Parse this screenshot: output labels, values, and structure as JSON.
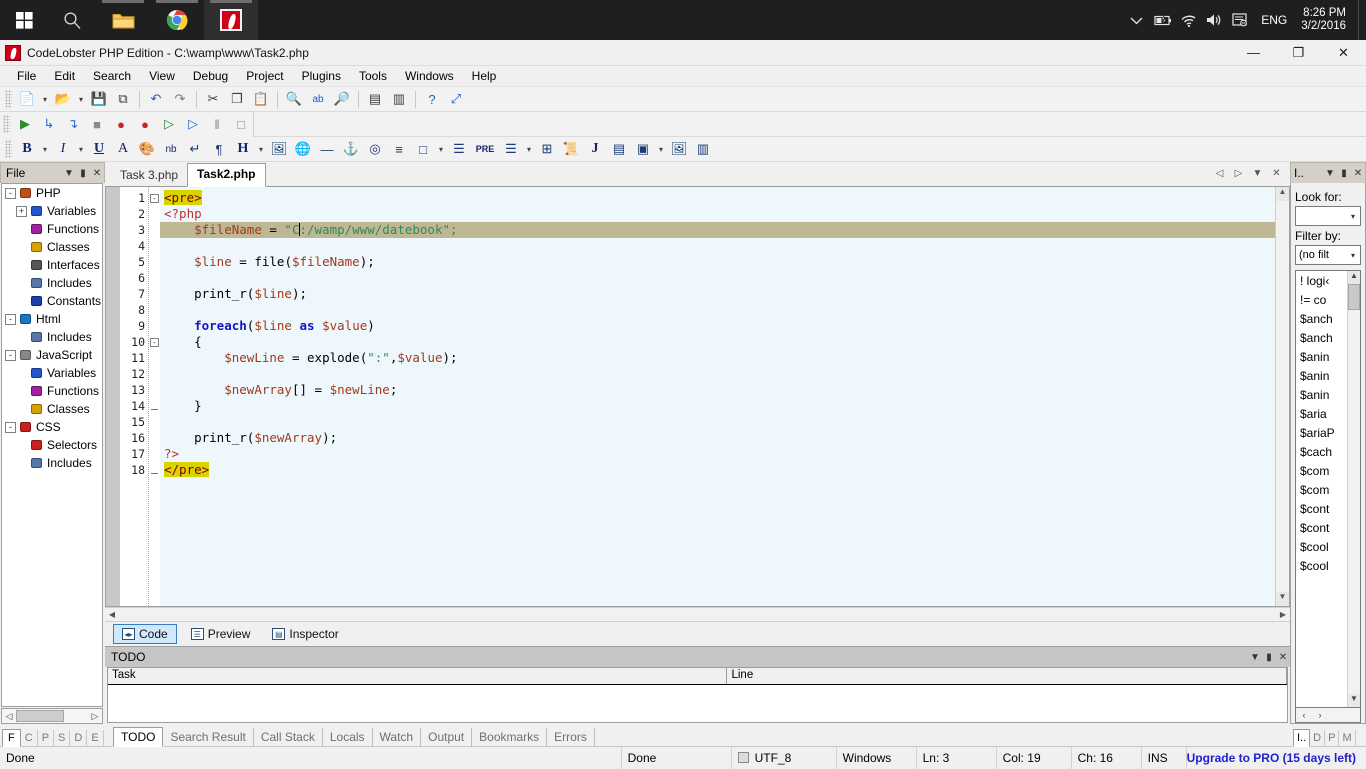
{
  "taskbar": {
    "start_icon": "windows-logo-icon",
    "items": [
      {
        "name": "search-icon",
        "glyph": "search"
      },
      {
        "name": "file-explorer-icon",
        "glyph": "folder"
      },
      {
        "name": "chrome-icon",
        "glyph": "chrome"
      },
      {
        "name": "codelobster-icon",
        "glyph": "codelobster",
        "active": true
      }
    ],
    "tray": {
      "chevron": "show-hidden-icons",
      "battery": "battery-charging-icon",
      "network": "wifi-icon",
      "volume": "speaker-icon",
      "action_center": "action-center-icon",
      "language": "ENG",
      "time": "8:26 PM",
      "date": "3/2/2016"
    }
  },
  "window": {
    "title": "CodeLobster PHP Edition - C:\\wamp\\www\\Task2.php",
    "minimize": "—",
    "maximize": "❐",
    "close": "✕"
  },
  "menu": [
    "File",
    "Edit",
    "Search",
    "View",
    "Debug",
    "Project",
    "Plugins",
    "Tools",
    "Windows",
    "Help"
  ],
  "toolbars": {
    "main": [
      {
        "name": "new-file-icon",
        "glyph": "📄"
      },
      {
        "name": "new-file-dropdown-icon",
        "glyph": "▾",
        "dd": true
      },
      {
        "name": "open-file-icon",
        "glyph": "📂"
      },
      {
        "name": "open-file-dropdown-icon",
        "glyph": "▾",
        "dd": true
      },
      {
        "name": "save-icon",
        "glyph": "💾"
      },
      {
        "name": "save-all-icon",
        "glyph": "⧉"
      },
      {
        "name": "separator",
        "glyph": "",
        "sep": true
      },
      {
        "name": "undo-icon",
        "glyph": "↶"
      },
      {
        "name": "redo-icon",
        "glyph": "↷"
      },
      {
        "name": "separator",
        "glyph": "",
        "sep": true
      },
      {
        "name": "cut-icon",
        "glyph": "✂"
      },
      {
        "name": "copy-icon",
        "glyph": "❐"
      },
      {
        "name": "paste-icon",
        "glyph": "📋"
      },
      {
        "name": "separator",
        "glyph": "",
        "sep": true
      },
      {
        "name": "find-icon",
        "glyph": "🔍"
      },
      {
        "name": "replace-icon",
        "glyph": "ab"
      },
      {
        "name": "find-in-files-icon",
        "glyph": "🔎"
      },
      {
        "name": "separator",
        "glyph": "",
        "sep": true
      },
      {
        "name": "split-view-icon",
        "glyph": "▤"
      },
      {
        "name": "project-properties-icon",
        "glyph": "▥"
      },
      {
        "name": "separator",
        "glyph": "",
        "sep": true
      },
      {
        "name": "help-icon",
        "glyph": "?"
      },
      {
        "name": "fullscreen-icon",
        "glyph": "⤢"
      }
    ],
    "debug": [
      {
        "name": "run-icon",
        "glyph": "▶"
      },
      {
        "name": "step-into-icon",
        "glyph": "↳"
      },
      {
        "name": "step-over-icon",
        "glyph": "↴"
      },
      {
        "name": "stop-icon",
        "glyph": "■"
      },
      {
        "name": "breakpoint-icon",
        "glyph": "●"
      },
      {
        "name": "remove-breakpoints-icon",
        "glyph": "●"
      },
      {
        "name": "run-to-cursor-icon",
        "glyph": "▷"
      },
      {
        "name": "continue-icon",
        "glyph": "▷"
      },
      {
        "name": "pause-icon",
        "glyph": "‖"
      },
      {
        "name": "terminate-icon",
        "glyph": "□"
      }
    ],
    "format": [
      {
        "name": "bold-icon",
        "glyph": "B"
      },
      {
        "name": "bold-dropdown-icon",
        "glyph": "▾",
        "dd": true
      },
      {
        "name": "italic-icon",
        "glyph": "I"
      },
      {
        "name": "italic-dropdown-icon",
        "glyph": "▾",
        "dd": true
      },
      {
        "name": "underline-icon",
        "glyph": "U"
      },
      {
        "name": "font-color-icon",
        "glyph": "A"
      },
      {
        "name": "palette-icon",
        "glyph": "🎨"
      },
      {
        "name": "nbsp-icon",
        "glyph": "nb"
      },
      {
        "name": "line-break-icon",
        "glyph": "↵"
      },
      {
        "name": "paragraph-icon",
        "glyph": "¶"
      },
      {
        "name": "heading-icon",
        "glyph": "H"
      },
      {
        "name": "heading-dropdown-icon",
        "glyph": "▾",
        "dd": true
      },
      {
        "name": "insert-image-icon",
        "glyph": "🖼"
      },
      {
        "name": "insert-link-icon",
        "glyph": "🌐"
      },
      {
        "name": "horizontal-rule-icon",
        "glyph": "—"
      },
      {
        "name": "anchor-icon",
        "glyph": "⚓"
      },
      {
        "name": "target-icon",
        "glyph": "◎"
      },
      {
        "name": "align-icon",
        "glyph": "≡"
      },
      {
        "name": "div-icon",
        "glyph": "□"
      },
      {
        "name": "div-dropdown-icon",
        "glyph": "▾",
        "dd": true
      },
      {
        "name": "align-justify-icon",
        "glyph": "☰"
      },
      {
        "name": "pre-icon",
        "glyph": "PRE"
      },
      {
        "name": "list-icon",
        "glyph": "☰"
      },
      {
        "name": "list-dropdown-icon",
        "glyph": "▾",
        "dd": true
      },
      {
        "name": "table-icon",
        "glyph": "⊞"
      },
      {
        "name": "script-icon",
        "glyph": "📜"
      },
      {
        "name": "javascript-icon",
        "glyph": "J"
      },
      {
        "name": "form-icon",
        "glyph": "▤"
      },
      {
        "name": "form-element-icon",
        "glyph": "▣"
      },
      {
        "name": "form-element-dropdown-icon",
        "glyph": "▾",
        "dd": true
      },
      {
        "name": "insert-media-icon",
        "glyph": "🖼"
      },
      {
        "name": "frames-icon",
        "glyph": "▥"
      }
    ]
  },
  "left_dock": {
    "title": "File",
    "controls": {
      "menu": "▼",
      "pin": "▮",
      "close": "✕"
    },
    "tree": [
      {
        "label": "PHP",
        "level": 0,
        "toggle": "-",
        "icon": "php-icon",
        "color": "#c05018"
      },
      {
        "label": "Variables",
        "level": 1,
        "toggle": "+",
        "icon": "variable-icon",
        "color": "#2255cc"
      },
      {
        "label": "Functions",
        "level": 1,
        "toggle": "",
        "icon": "function-icon",
        "color": "#a020a0"
      },
      {
        "label": "Classes",
        "level": 1,
        "toggle": "",
        "icon": "class-icon",
        "color": "#d8a000"
      },
      {
        "label": "Interfaces",
        "level": 1,
        "toggle": "",
        "icon": "interface-icon",
        "color": "#555555"
      },
      {
        "label": "Includes",
        "level": 1,
        "toggle": "",
        "icon": "include-icon",
        "color": "#5577aa"
      },
      {
        "label": "Constants",
        "level": 1,
        "toggle": "",
        "icon": "constant-icon",
        "color": "#1a3fb0"
      },
      {
        "label": "Html",
        "level": 0,
        "toggle": "-",
        "icon": "html-icon",
        "color": "#1878c8"
      },
      {
        "label": "Includes",
        "level": 1,
        "toggle": "",
        "icon": "include-icon",
        "color": "#5577aa"
      },
      {
        "label": "JavaScript",
        "level": 0,
        "toggle": "-",
        "icon": "javascript-icon",
        "color": "#888888"
      },
      {
        "label": "Variables",
        "level": 1,
        "toggle": "",
        "icon": "variable-icon",
        "color": "#2255cc"
      },
      {
        "label": "Functions",
        "level": 1,
        "toggle": "",
        "icon": "function-icon",
        "color": "#a020a0"
      },
      {
        "label": "Classes",
        "level": 1,
        "toggle": "",
        "icon": "class-icon",
        "color": "#d8a000"
      },
      {
        "label": "CSS",
        "level": 0,
        "toggle": "-",
        "icon": "css-icon",
        "color": "#cc2020"
      },
      {
        "label": "Selectors",
        "level": 1,
        "toggle": "",
        "icon": "selector-icon",
        "color": "#cc2020"
      },
      {
        "label": "Includes",
        "level": 1,
        "toggle": "",
        "icon": "include-icon",
        "color": "#5577aa"
      }
    ],
    "tabs": [
      {
        "label": "F",
        "active": true
      },
      {
        "label": "C",
        "active": false
      },
      {
        "label": "P",
        "active": false
      },
      {
        "label": "S",
        "active": false
      },
      {
        "label": "D",
        "active": false
      },
      {
        "label": "E",
        "active": false
      }
    ]
  },
  "editor": {
    "tabs": [
      {
        "label": "Task 3.php",
        "active": false
      },
      {
        "label": "Task2.php",
        "active": true
      }
    ],
    "tab_controls": [
      {
        "name": "tab-prev-button",
        "glyph": "◁"
      },
      {
        "name": "tab-next-button",
        "glyph": "▷"
      },
      {
        "name": "tab-list-button",
        "glyph": "▼"
      },
      {
        "name": "tab-close-button",
        "glyph": "✕"
      }
    ],
    "highlighted_line": 3,
    "fold_lines": [
      1,
      10,
      14,
      18
    ],
    "lines": [
      {
        "n": 1,
        "tokens": [
          {
            "t": "<pre>",
            "c": "tok-tag"
          }
        ]
      },
      {
        "n": 2,
        "tokens": [
          {
            "t": "<?php",
            "c": "tok-php"
          }
        ]
      },
      {
        "n": 3,
        "tokens": [
          {
            "t": "    ",
            "c": "tok-pun"
          },
          {
            "t": "$fileName",
            "c": "tok-var"
          },
          {
            "t": " = ",
            "c": "tok-pun"
          },
          {
            "t": "\"C",
            "c": "tok-str"
          },
          {
            "t": "|CARET|",
            "c": "caret"
          },
          {
            "t": ":/wamp/www/datebook\";",
            "c": "tok-str"
          }
        ]
      },
      {
        "n": 4,
        "tokens": []
      },
      {
        "n": 5,
        "tokens": [
          {
            "t": "    ",
            "c": "tok-pun"
          },
          {
            "t": "$line",
            "c": "tok-var"
          },
          {
            "t": " = ",
            "c": "tok-pun"
          },
          {
            "t": "file",
            "c": "tok-fn"
          },
          {
            "t": "(",
            "c": "tok-pun"
          },
          {
            "t": "$fileName",
            "c": "tok-var"
          },
          {
            "t": ");",
            "c": "tok-pun"
          }
        ]
      },
      {
        "n": 6,
        "tokens": []
      },
      {
        "n": 7,
        "tokens": [
          {
            "t": "    ",
            "c": "tok-pun"
          },
          {
            "t": "print_r",
            "c": "tok-fn"
          },
          {
            "t": "(",
            "c": "tok-pun"
          },
          {
            "t": "$line",
            "c": "tok-var"
          },
          {
            "t": ");",
            "c": "tok-pun"
          }
        ]
      },
      {
        "n": 8,
        "tokens": []
      },
      {
        "n": 9,
        "tokens": [
          {
            "t": "    ",
            "c": "tok-pun"
          },
          {
            "t": "foreach",
            "c": "tok-kw"
          },
          {
            "t": "(",
            "c": "tok-pun"
          },
          {
            "t": "$line",
            "c": "tok-var"
          },
          {
            "t": " ",
            "c": "tok-pun"
          },
          {
            "t": "as",
            "c": "tok-kw"
          },
          {
            "t": " ",
            "c": "tok-pun"
          },
          {
            "t": "$value",
            "c": "tok-var"
          },
          {
            "t": ")",
            "c": "tok-pun"
          }
        ]
      },
      {
        "n": 10,
        "tokens": [
          {
            "t": "    {",
            "c": "tok-pun"
          }
        ]
      },
      {
        "n": 11,
        "tokens": [
          {
            "t": "        ",
            "c": "tok-pun"
          },
          {
            "t": "$newLine",
            "c": "tok-var"
          },
          {
            "t": " = ",
            "c": "tok-pun"
          },
          {
            "t": "explode",
            "c": "tok-fn"
          },
          {
            "t": "(",
            "c": "tok-pun"
          },
          {
            "t": "\":\"",
            "c": "tok-str"
          },
          {
            "t": ",",
            "c": "tok-pun"
          },
          {
            "t": "$value",
            "c": "tok-var"
          },
          {
            "t": ");",
            "c": "tok-pun"
          }
        ]
      },
      {
        "n": 12,
        "tokens": []
      },
      {
        "n": 13,
        "tokens": [
          {
            "t": "        ",
            "c": "tok-pun"
          },
          {
            "t": "$newArray",
            "c": "tok-var"
          },
          {
            "t": "[] = ",
            "c": "tok-pun"
          },
          {
            "t": "$newLine",
            "c": "tok-var"
          },
          {
            "t": ";",
            "c": "tok-pun"
          }
        ]
      },
      {
        "n": 14,
        "tokens": [
          {
            "t": "    }",
            "c": "tok-pun"
          }
        ]
      },
      {
        "n": 15,
        "tokens": []
      },
      {
        "n": 16,
        "tokens": [
          {
            "t": "    ",
            "c": "tok-pun"
          },
          {
            "t": "print_r",
            "c": "tok-fn"
          },
          {
            "t": "(",
            "c": "tok-pun"
          },
          {
            "t": "$newArray",
            "c": "tok-var"
          },
          {
            "t": ");",
            "c": "tok-pun"
          }
        ]
      },
      {
        "n": 17,
        "tokens": [
          {
            "t": "?>",
            "c": "tok-php"
          }
        ]
      },
      {
        "n": 18,
        "tokens": [
          {
            "t": "</pre>",
            "c": "tok-tag"
          }
        ]
      }
    ]
  },
  "view_tabs": [
    {
      "label": "Code",
      "icon": "code-icon",
      "glyph": "◂▸",
      "active": true
    },
    {
      "label": "Preview",
      "icon": "preview-icon",
      "glyph": "☰",
      "active": false
    },
    {
      "label": "Inspector",
      "icon": "inspector-icon",
      "glyph": "▤",
      "active": false
    }
  ],
  "todo": {
    "title": "TODO",
    "controls": {
      "menu": "▼",
      "pin": "▮",
      "close": "✕"
    },
    "columns": [
      "Task",
      "Line"
    ],
    "rows": [],
    "tabs": [
      {
        "label": "TODO",
        "active": true
      },
      {
        "label": "Search Result",
        "active": false
      },
      {
        "label": "Call Stack",
        "active": false
      },
      {
        "label": "Locals",
        "active": false
      },
      {
        "label": "Watch",
        "active": false
      },
      {
        "label": "Output",
        "active": false
      },
      {
        "label": "Bookmarks",
        "active": false
      },
      {
        "label": "Errors",
        "active": false
      }
    ]
  },
  "right_dock": {
    "title": "I..",
    "controls": {
      "menu": "▼",
      "pin": "▮",
      "close": "✕"
    },
    "look_for_label": "Look for:",
    "look_for_value": "",
    "filter_by_label": "Filter by:",
    "filter_by_value": "(no filt",
    "items": [
      "! logi‹",
      "!= co",
      "$anch",
      "$anch",
      "$anin",
      "$anin",
      "$anin",
      "$aria",
      "$ariaP",
      "$cach",
      "$com",
      "$com",
      "$cont",
      "$cont",
      "$cool",
      "$cool"
    ],
    "tabs": [
      {
        "label": "I..",
        "active": true
      },
      {
        "label": "D",
        "active": false
      },
      {
        "label": "P",
        "active": false
      },
      {
        "label": "M",
        "active": false
      }
    ]
  },
  "statusbar": {
    "message": "Done",
    "state": "Done",
    "encoding": "UTF_8",
    "line_ending": "Windows",
    "line": "Ln: 3",
    "col": "Col: 19",
    "ch": "Ch: 16",
    "insert_mode": "INS",
    "upgrade": "Upgrade to PRO (15 days left)",
    "upgrade_color": "#2020d0"
  }
}
